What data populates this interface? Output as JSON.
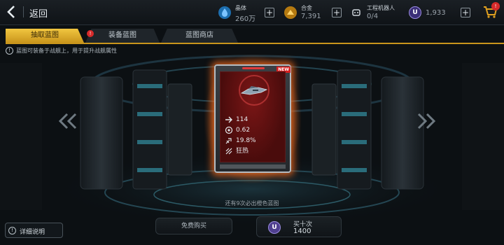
{
  "header": {
    "back_label": "返回",
    "resources": [
      {
        "name": "晶体",
        "value": "260万",
        "icon": "crystal-icon",
        "color": "#2b8fd8"
      },
      {
        "name": "合金",
        "value": "7,391",
        "icon": "alloy-icon",
        "color": "#e0a020"
      },
      {
        "name": "工程机器人",
        "value": "0/4",
        "icon": "robot-icon",
        "color": "#cfd6dc"
      },
      {
        "name": "",
        "value": "1,933",
        "icon": "u-coin-icon",
        "color": "#6a5ad0"
      }
    ],
    "plus_label": "+",
    "cart_badge": "!"
  },
  "tabs": [
    {
      "label": "抽取蓝图",
      "active": true
    },
    {
      "label": "装备蓝图",
      "active": false,
      "badge": "!"
    },
    {
      "label": "蓝图商店",
      "active": false
    }
  ],
  "info": {
    "icon_text": "!",
    "text": "蓝图可装备于战舰上，用于提升战舰属性"
  },
  "card": {
    "new_label": "NEW",
    "stats": [
      {
        "icon": "arrow-right-icon",
        "value": "114"
      },
      {
        "icon": "target-icon",
        "value": "0.62"
      },
      {
        "icon": "crit-icon",
        "value": "19.8%"
      },
      {
        "icon": "frenzy-icon",
        "value": "狂热"
      }
    ]
  },
  "hint": "还有9次必出橙色蓝图",
  "buttons": {
    "detail_icon": "!",
    "detail_label": "详细说明",
    "free_label": "免费购买",
    "ten_label": "买十次",
    "ten_price": "1400",
    "coin_letter": "U"
  },
  "colors": {
    "accent_gold": "#c9951c",
    "card_glow": "#ff7a28",
    "card_red": "#7b1616"
  }
}
